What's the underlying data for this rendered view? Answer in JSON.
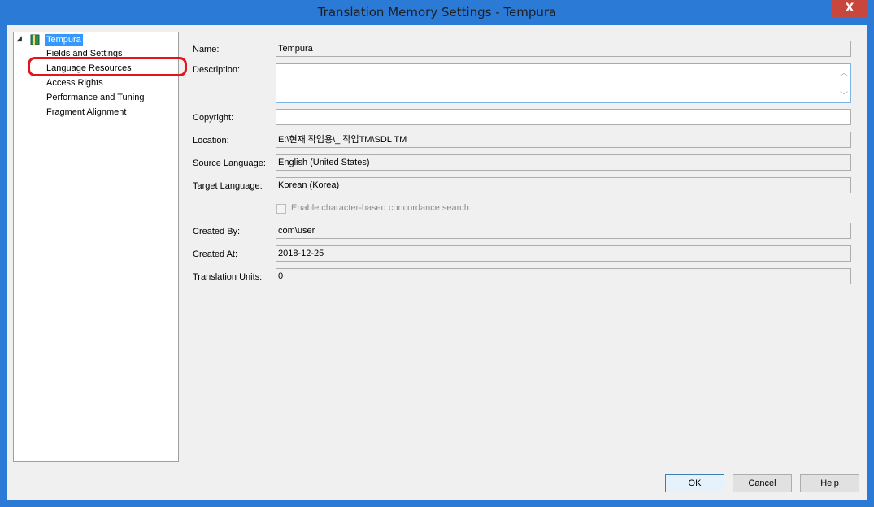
{
  "window": {
    "title": "Translation Memory Settings - Tempura",
    "close_glyph": "X"
  },
  "tree": {
    "root": {
      "label": "Tempura",
      "expand_glyph": "◢"
    },
    "items": [
      {
        "label": "Fields and Settings"
      },
      {
        "label": "Language Resources"
      },
      {
        "label": "Access Rights"
      },
      {
        "label": "Performance and Tuning"
      },
      {
        "label": "Fragment Alignment"
      }
    ]
  },
  "form": {
    "name_label": "Name:",
    "name_value": "Tempura",
    "description_label": "Description:",
    "description_value": "",
    "copyright_label": "Copyright:",
    "copyright_value": "",
    "location_label": "Location:",
    "location_value": "E:\\현재 작업용\\_ 작업TM\\SDL TM",
    "source_language_label": "Source Language:",
    "source_language_value": "English (United States)",
    "target_language_label": "Target Language:",
    "target_language_value": "Korean (Korea)",
    "concordance_label": "Enable character-based concordance search",
    "concordance_checked": false,
    "created_by_label": "Created By:",
    "created_by_value": "com\\user",
    "created_at_label": "Created At:",
    "created_at_value": "2018-12-25",
    "translation_units_label": "Translation Units:",
    "translation_units_value": "0"
  },
  "buttons": {
    "ok": "OK",
    "cancel": "Cancel",
    "help": "Help"
  },
  "colors": {
    "frame": "#2b7ad6",
    "selection": "#3399ff",
    "annotation": "#e4141c",
    "close": "#c7463e"
  }
}
